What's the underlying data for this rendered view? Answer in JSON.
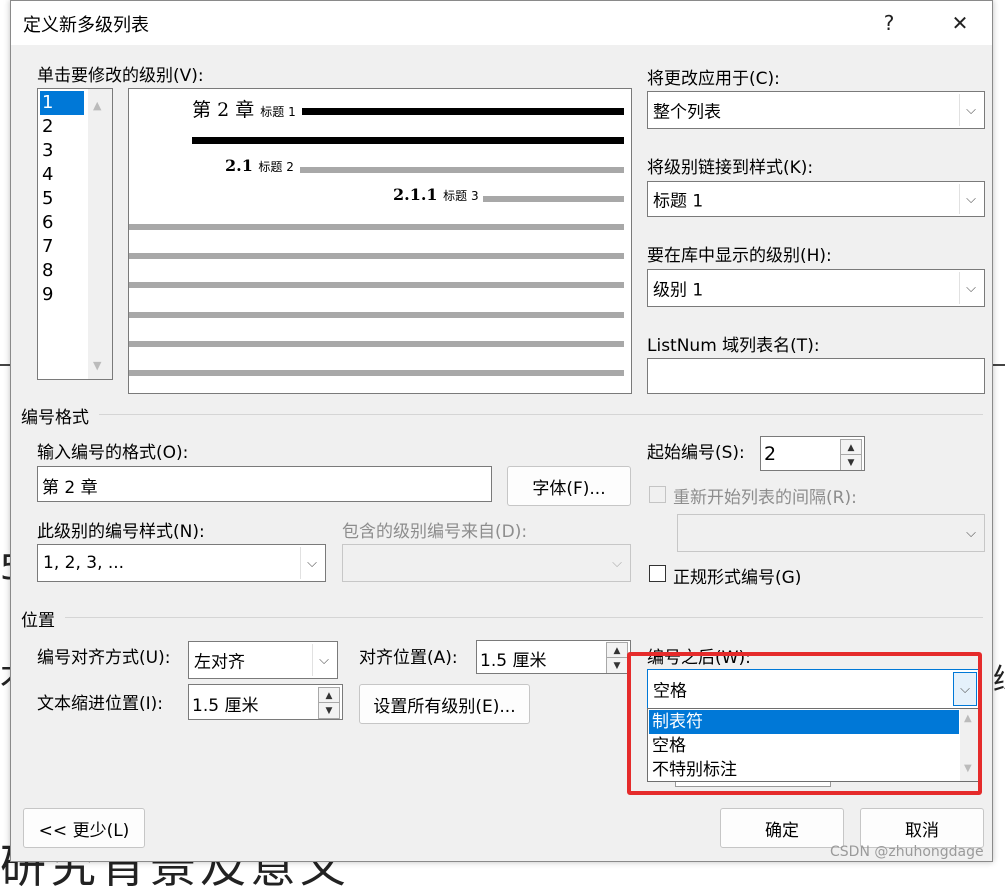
{
  "background_doc": {
    "fragments": [
      "5",
      "术",
      "绿",
      "研究背景及意义"
    ]
  },
  "dialog": {
    "title": "定义新多级列表",
    "help_button": "?",
    "close_button": "✕",
    "level_list": {
      "label": "单击要修改的级别(V):",
      "items": [
        "1",
        "2",
        "3",
        "4",
        "5",
        "6",
        "7",
        "8",
        "9"
      ],
      "selected": "1"
    },
    "preview": {
      "line1_prefix": "第",
      "line1_num": "2",
      "line1_suffix": "章",
      "line1_style": "标题 1",
      "line2_num": "2.1",
      "line2_style": "标题 2",
      "line3_num": "2.1.1",
      "line3_style": "标题 3"
    },
    "apply_to": {
      "label": "将更改应用于(C):",
      "value": "整个列表"
    },
    "link_style": {
      "label": "将级别链接到样式(K):",
      "value": "标题 1"
    },
    "gallery_level": {
      "label": "要在库中显示的级别(H):",
      "value": "级别 1"
    },
    "listnum": {
      "label": "ListNum 域列表名(T):",
      "value": ""
    },
    "number_format": {
      "group": "编号格式",
      "format_label": "输入编号的格式(O):",
      "format_value": "第 2 章",
      "font_button": "字体(F)...",
      "style_label": "此级别的编号样式(N):",
      "style_value": "1, 2, 3, ...",
      "include_label": "包含的级别编号来自(D):",
      "include_value": "",
      "start_label": "起始编号(S):",
      "start_value": "2",
      "restart_label": "重新开始列表的间隔(R):",
      "restart_value": "",
      "legal_label": "正规形式编号(G)"
    },
    "position": {
      "group": "位置",
      "align_label": "编号对齐方式(U):",
      "align_value": "左对齐",
      "align_at_label": "对齐位置(A):",
      "align_at_value": "1.5 厘米",
      "indent_label": "文本缩进位置(I):",
      "indent_value": "1.5 厘米",
      "set_all_button": "设置所有级别(E)...",
      "follow_label": "编号之后(W):",
      "follow_value": "空格",
      "follow_options": [
        "制表符",
        "空格",
        "不特别标注"
      ],
      "follow_selected": "制表符"
    },
    "less_button": "<< 更少(L)",
    "ok_button": "确定",
    "cancel_button": "取消"
  },
  "watermark": "CSDN @zhuhongdage",
  "colors": {
    "highlight": "#0078d7",
    "annotation": "#e52b2b"
  },
  "icons": {
    "dropdown": "chevron-down-icon",
    "spin_up": "triangle-up-icon",
    "spin_down": "triangle-down-icon"
  }
}
